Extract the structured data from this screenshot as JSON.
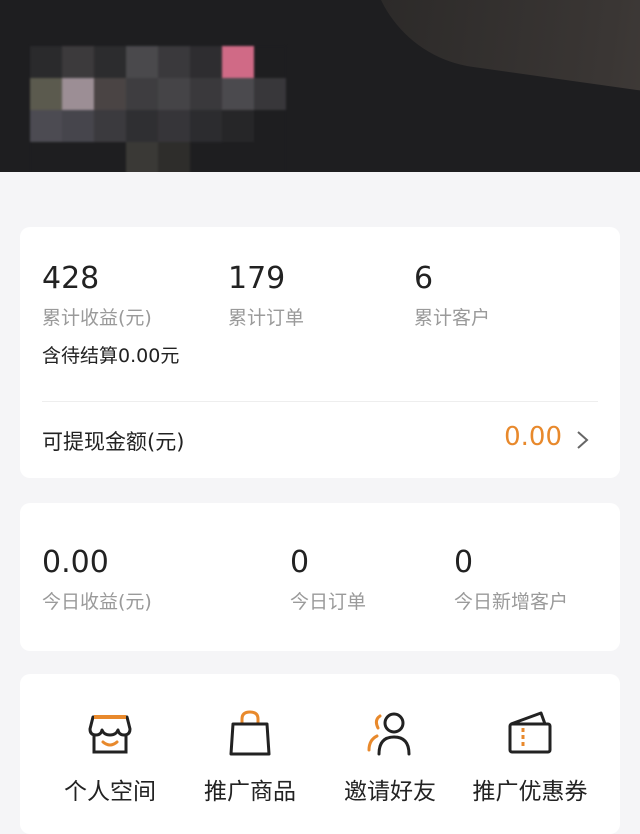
{
  "cumulative": {
    "earnings": {
      "value": "428",
      "label": "累计收益(元)"
    },
    "orders": {
      "value": "179",
      "label": "累计订单"
    },
    "customers": {
      "value": "6",
      "label": "累计客户"
    },
    "pending_prefix": "含待结算",
    "pending_amount": "0.00",
    "pending_suffix": "元"
  },
  "withdraw": {
    "label": "可提现金额(元)",
    "amount": "0.00"
  },
  "today": {
    "earnings": {
      "value": "0.00",
      "label": "今日收益(元)"
    },
    "orders": {
      "value": "0",
      "label": "今日订单"
    },
    "new_customers": {
      "value": "0",
      "label": "今日新增客户"
    }
  },
  "features": [
    {
      "label": "个人空间",
      "icon": "storefront-icon"
    },
    {
      "label": "推广商品",
      "icon": "shopping-bag-icon"
    },
    {
      "label": "邀请好友",
      "icon": "invite-users-icon"
    },
    {
      "label": "推广优惠券",
      "icon": "coupon-icon"
    }
  ],
  "colors": {
    "accent": "#e8892c",
    "header_bg": "#1e1e20",
    "page_bg": "#f5f5f7"
  }
}
